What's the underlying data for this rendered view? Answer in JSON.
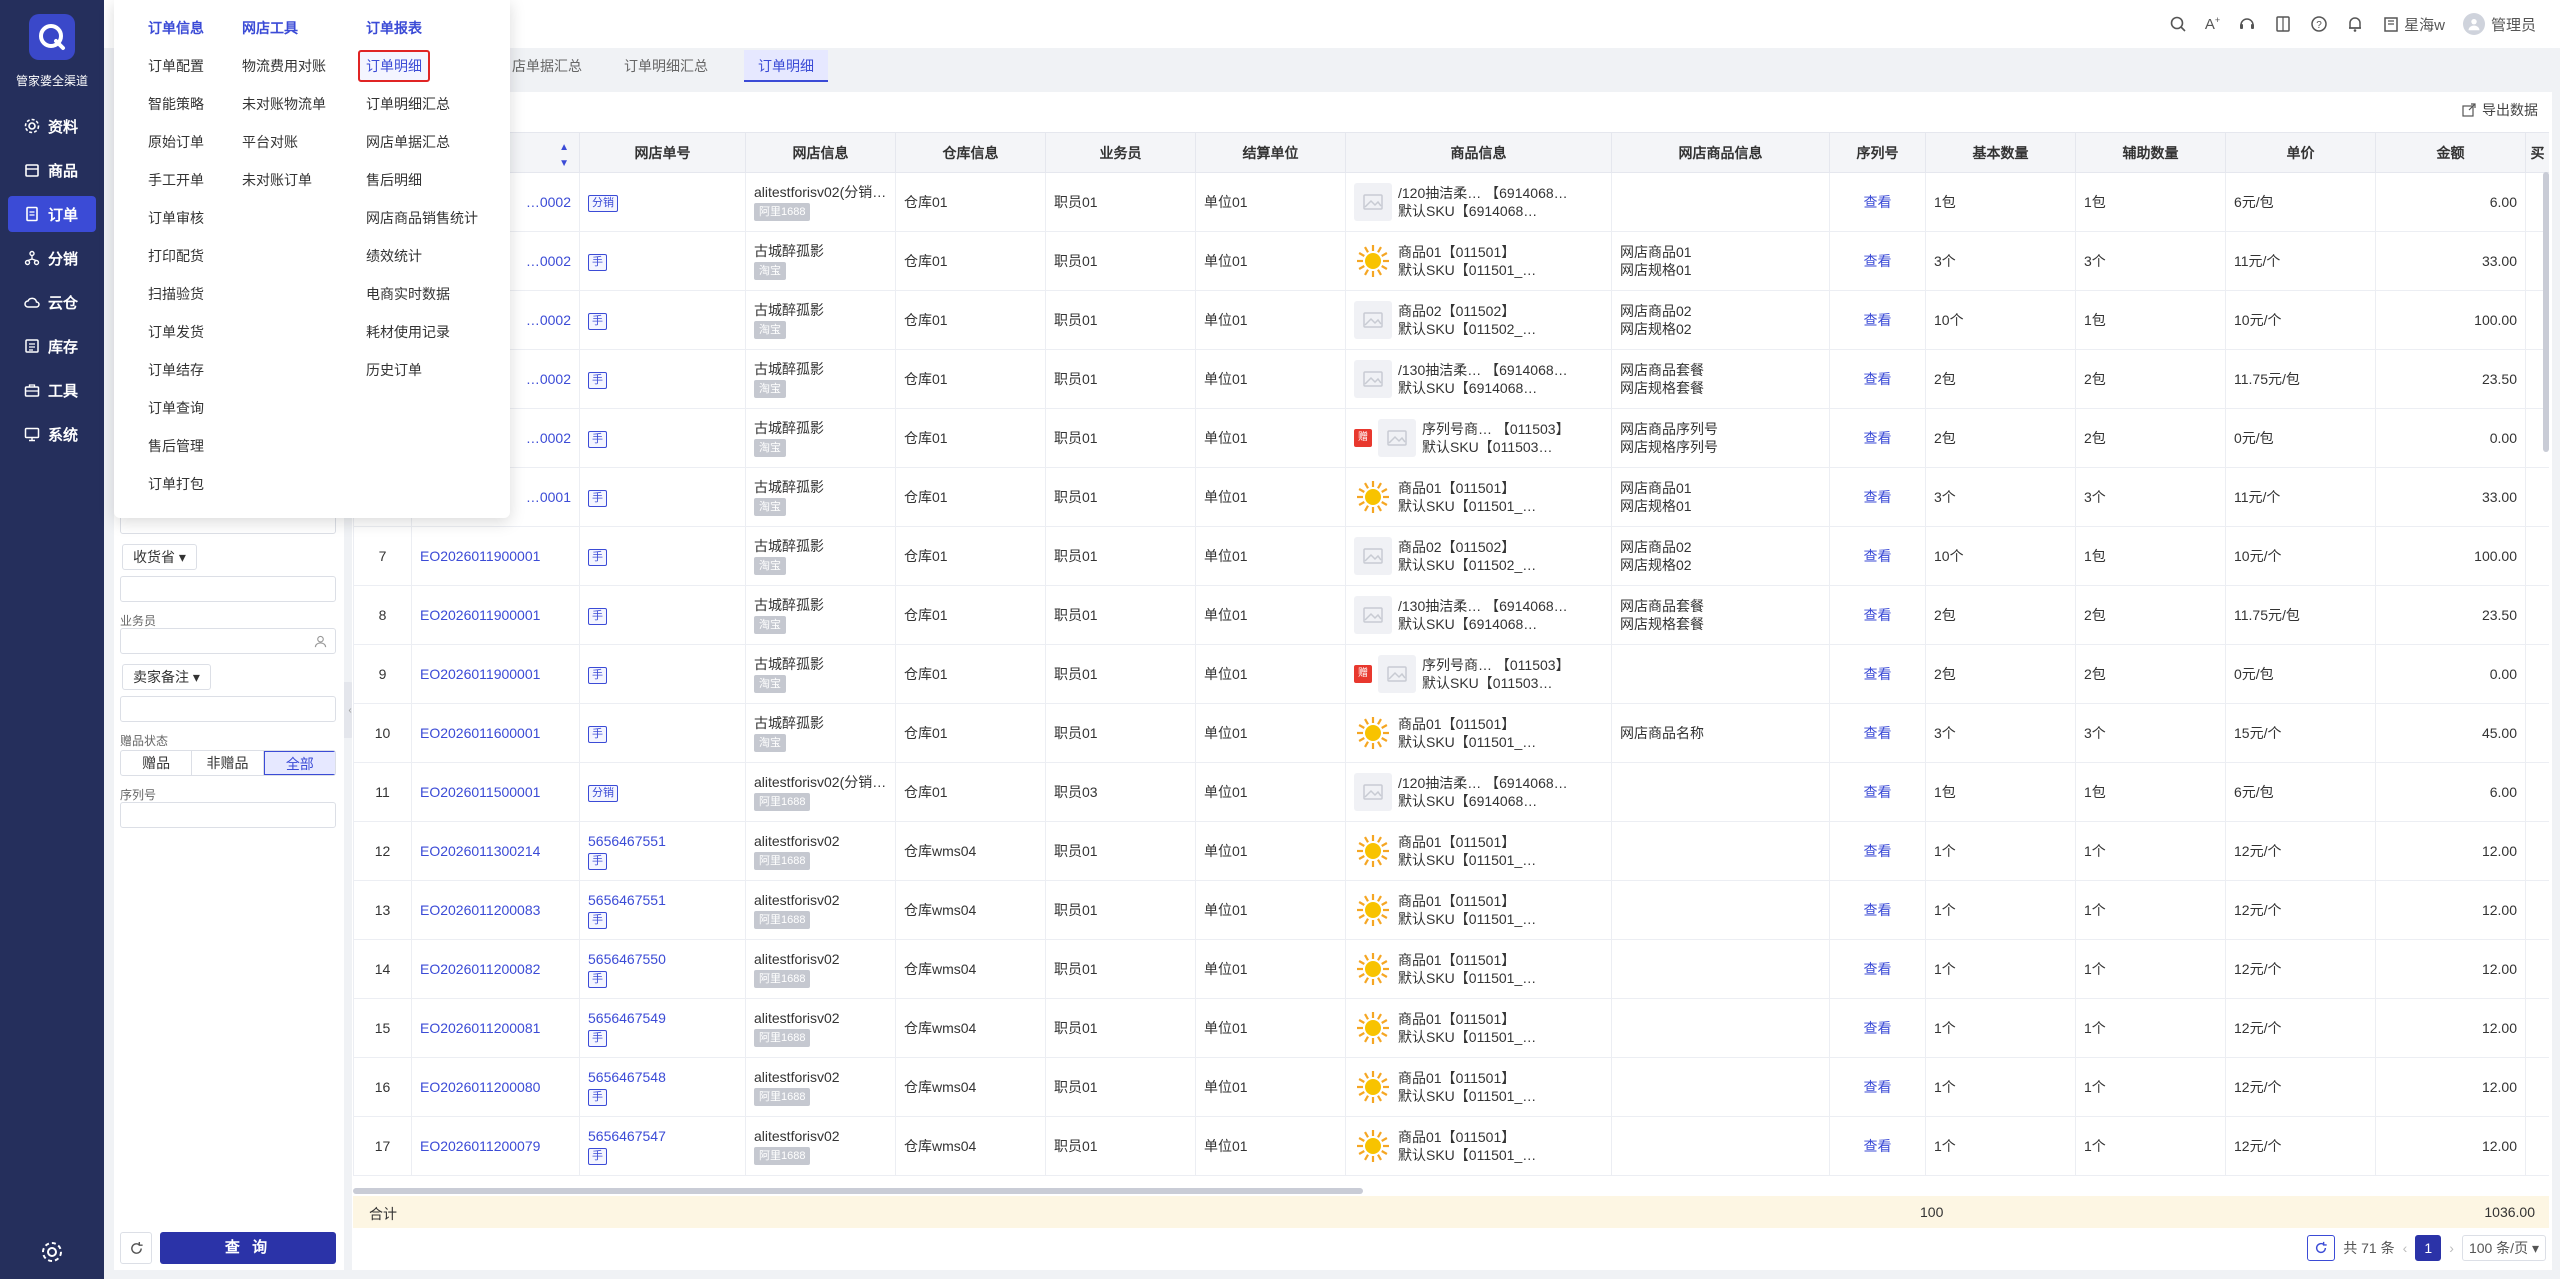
{
  "app": {
    "logo_text": "管家婆全渠道",
    "nav": [
      {
        "label": "资料",
        "icon": "gear-icon"
      },
      {
        "label": "商品",
        "icon": "box-icon"
      },
      {
        "label": "订单",
        "icon": "document-icon",
        "active": true
      },
      {
        "label": "分销",
        "icon": "network-icon"
      },
      {
        "label": "云仓",
        "icon": "cloud-icon"
      },
      {
        "label": "库存",
        "icon": "stack-icon"
      },
      {
        "label": "工具",
        "icon": "toolbox-icon"
      },
      {
        "label": "系统",
        "icon": "monitor-icon"
      }
    ],
    "accent": "#3b4bd6",
    "sidebar_bg": "#252f5c"
  },
  "header": {
    "store": "星海w",
    "user": "管理员",
    "icons": [
      "search-icon",
      "font-size-icon",
      "support-icon",
      "book-icon",
      "help-icon",
      "bell-icon"
    ]
  },
  "tabs": [
    {
      "label": "店单据汇总",
      "active": false
    },
    {
      "label": "订单明细汇总",
      "active": false
    },
    {
      "label": "订单明细",
      "active": true
    }
  ],
  "menu": {
    "columns": [
      {
        "header": "订单信息",
        "items": [
          "订单配置",
          "智能策略",
          "原始订单",
          "手工开单",
          "订单审核",
          "打印配货",
          "扫描验货",
          "订单发货",
          "订单结存",
          "订单查询",
          "售后管理",
          "订单打包"
        ]
      },
      {
        "header": "网店工具",
        "items": [
          "物流费用对账",
          "未对账物流单",
          "平台对账",
          "未对账订单"
        ]
      },
      {
        "header": "订单报表",
        "items": [
          "订单明细",
          "订单明细汇总",
          "网店单据汇总",
          "售后明细",
          "网店商品销售统计",
          "绩效统计",
          "电商实时数据",
          "耗材使用记录",
          "历史订单"
        ]
      }
    ],
    "highlighted": "订单明细"
  },
  "filter": {
    "province": "收货省",
    "salesman_label": "业务员",
    "seller_note": "卖家备注",
    "gift_label": "赠品状态",
    "gift_options": [
      "赠品",
      "非赠品",
      "全部"
    ],
    "gift_selected": "全部",
    "serial_label": "序列号",
    "query": "查 询"
  },
  "toolbar": {
    "export": "导出数据"
  },
  "table": {
    "columns": [
      "",
      "",
      "网店单号",
      "网店信息",
      "仓库信息",
      "业务员",
      "结算单位",
      "商品信息",
      "网店商品信息",
      "序列号",
      "基本数量",
      "辅助数量",
      "单价",
      "金额",
      "买"
    ],
    "rows": [
      {
        "idx": "",
        "order": "…0002",
        "shop_no": "",
        "tag": "分销",
        "shop": "alitestforisv02(分销…",
        "shop_tag": "阿里1688",
        "wh": "仓库01",
        "sales": "职员01",
        "unit": "单位01",
        "thumb": "img",
        "gift": false,
        "p1": "/120抽洁柔…  【6914068…",
        "p2": "默认SKU【6914068…",
        "sp1": "",
        "sp2": "",
        "serial": "查看",
        "q1": "1包",
        "q2": "1包",
        "price": "6元/包",
        "amt": "6.00"
      },
      {
        "idx": "",
        "order": "…0002",
        "shop_no": "",
        "tag": "手",
        "shop": "古城醉孤影",
        "shop_tag": "淘宝",
        "wh": "仓库01",
        "sales": "职员01",
        "unit": "单位01",
        "thumb": "sun",
        "gift": false,
        "p1": "商品01【011501】",
        "p2": "默认SKU【011501_…",
        "sp1": "网店商品01",
        "sp2": "网店规格01",
        "serial": "查看",
        "q1": "3个",
        "q2": "3个",
        "price": "11元/个",
        "amt": "33.00"
      },
      {
        "idx": "",
        "order": "…0002",
        "shop_no": "",
        "tag": "手",
        "shop": "古城醉孤影",
        "shop_tag": "淘宝",
        "wh": "仓库01",
        "sales": "职员01",
        "unit": "单位01",
        "thumb": "img",
        "gift": false,
        "p1": "商品02【011502】",
        "p2": "默认SKU【011502_…",
        "sp1": "网店商品02",
        "sp2": "网店规格02",
        "serial": "查看",
        "q1": "10个",
        "q2": "1包",
        "price": "10元/个",
        "amt": "100.00"
      },
      {
        "idx": "",
        "order": "…0002",
        "shop_no": "",
        "tag": "手",
        "shop": "古城醉孤影",
        "shop_tag": "淘宝",
        "wh": "仓库01",
        "sales": "职员01",
        "unit": "单位01",
        "thumb": "img",
        "gift": false,
        "p1": "/130抽洁柔…  【6914068…",
        "p2": "默认SKU【6914068…",
        "sp1": "网店商品套餐",
        "sp2": "网店规格套餐",
        "serial": "查看",
        "q1": "2包",
        "q2": "2包",
        "price": "11.75元/包",
        "amt": "23.50"
      },
      {
        "idx": "",
        "order": "…0002",
        "shop_no": "",
        "tag": "手",
        "shop": "古城醉孤影",
        "shop_tag": "淘宝",
        "wh": "仓库01",
        "sales": "职员01",
        "unit": "单位01",
        "thumb": "img",
        "gift": true,
        "p1": "序列号商…  【011503】",
        "p2": "默认SKU【011503…",
        "sp1": "网店商品序列号",
        "sp2": "网店规格序列号",
        "serial": "查看",
        "q1": "2包",
        "q2": "2包",
        "price": "0元/包",
        "amt": "0.00"
      },
      {
        "idx": "",
        "order": "…0001",
        "shop_no": "",
        "tag": "手",
        "shop": "古城醉孤影",
        "shop_tag": "淘宝",
        "wh": "仓库01",
        "sales": "职员01",
        "unit": "单位01",
        "thumb": "sun",
        "gift": false,
        "p1": "商品01【011501】",
        "p2": "默认SKU【011501_…",
        "sp1": "网店商品01",
        "sp2": "网店规格01",
        "serial": "查看",
        "q1": "3个",
        "q2": "3个",
        "price": "11元/个",
        "amt": "33.00"
      },
      {
        "idx": "7",
        "order": "EO2026011900001",
        "shop_no": "",
        "tag": "手",
        "shop": "古城醉孤影",
        "shop_tag": "淘宝",
        "wh": "仓库01",
        "sales": "职员01",
        "unit": "单位01",
        "thumb": "img",
        "gift": false,
        "p1": "商品02【011502】",
        "p2": "默认SKU【011502_…",
        "sp1": "网店商品02",
        "sp2": "网店规格02",
        "serial": "查看",
        "q1": "10个",
        "q2": "1包",
        "price": "10元/个",
        "amt": "100.00"
      },
      {
        "idx": "8",
        "order": "EO2026011900001",
        "shop_no": "",
        "tag": "手",
        "shop": "古城醉孤影",
        "shop_tag": "淘宝",
        "wh": "仓库01",
        "sales": "职员01",
        "unit": "单位01",
        "thumb": "img",
        "gift": false,
        "p1": "/130抽洁柔…  【6914068…",
        "p2": "默认SKU【6914068…",
        "sp1": "网店商品套餐",
        "sp2": "网店规格套餐",
        "serial": "查看",
        "q1": "2包",
        "q2": "2包",
        "price": "11.75元/包",
        "amt": "23.50"
      },
      {
        "idx": "9",
        "order": "EO2026011900001",
        "shop_no": "",
        "tag": "手",
        "shop": "古城醉孤影",
        "shop_tag": "淘宝",
        "wh": "仓库01",
        "sales": "职员01",
        "unit": "单位01",
        "thumb": "img",
        "gift": true,
        "p1": "序列号商…  【011503】",
        "p2": "默认SKU【011503…",
        "sp1": "",
        "sp2": "",
        "serial": "查看",
        "q1": "2包",
        "q2": "2包",
        "price": "0元/包",
        "amt": "0.00"
      },
      {
        "idx": "10",
        "order": "EO2026011600001",
        "shop_no": "",
        "tag": "手",
        "shop": "古城醉孤影",
        "shop_tag": "淘宝",
        "wh": "仓库01",
        "sales": "职员01",
        "unit": "单位01",
        "thumb": "sun",
        "gift": false,
        "p1": "商品01【011501】",
        "p2": "默认SKU【011501_…",
        "sp1": "网店商品名称",
        "sp2": "",
        "serial": "查看",
        "q1": "3个",
        "q2": "3个",
        "price": "15元/个",
        "amt": "45.00"
      },
      {
        "idx": "11",
        "order": "EO2026011500001",
        "shop_no": "",
        "tag": "分销",
        "shop": "alitestforisv02(分销…",
        "shop_tag": "阿里1688",
        "wh": "仓库01",
        "sales": "职员03",
        "unit": "单位01",
        "thumb": "img",
        "gift": false,
        "p1": "/120抽洁柔…  【6914068…",
        "p2": "默认SKU【6914068…",
        "sp1": "",
        "sp2": "",
        "serial": "查看",
        "q1": "1包",
        "q2": "1包",
        "price": "6元/包",
        "amt": "6.00"
      },
      {
        "idx": "12",
        "order": "EO2026011300214",
        "shop_no": "5656467551",
        "tag": "手",
        "shop": "alitestforisv02",
        "shop_tag": "阿里1688",
        "wh": "仓库wms04",
        "sales": "职员01",
        "unit": "单位01",
        "thumb": "sun",
        "gift": false,
        "p1": "商品01【011501】",
        "p2": "默认SKU【011501_…",
        "sp1": "",
        "sp2": "",
        "serial": "查看",
        "q1": "1个",
        "q2": "1个",
        "price": "12元/个",
        "amt": "12.00"
      },
      {
        "idx": "13",
        "order": "EO2026011200083",
        "shop_no": "5656467551",
        "tag": "手",
        "shop": "alitestforisv02",
        "shop_tag": "阿里1688",
        "wh": "仓库wms04",
        "sales": "职员01",
        "unit": "单位01",
        "thumb": "sun",
        "gift": false,
        "p1": "商品01【011501】",
        "p2": "默认SKU【011501_…",
        "sp1": "",
        "sp2": "",
        "serial": "查看",
        "q1": "1个",
        "q2": "1个",
        "price": "12元/个",
        "amt": "12.00"
      },
      {
        "idx": "14",
        "order": "EO2026011200082",
        "shop_no": "5656467550",
        "tag": "手",
        "shop": "alitestforisv02",
        "shop_tag": "阿里1688",
        "wh": "仓库wms04",
        "sales": "职员01",
        "unit": "单位01",
        "thumb": "sun",
        "gift": false,
        "p1": "商品01【011501】",
        "p2": "默认SKU【011501_…",
        "sp1": "",
        "sp2": "",
        "serial": "查看",
        "q1": "1个",
        "q2": "1个",
        "price": "12元/个",
        "amt": "12.00"
      },
      {
        "idx": "15",
        "order": "EO2026011200081",
        "shop_no": "5656467549",
        "tag": "手",
        "shop": "alitestforisv02",
        "shop_tag": "阿里1688",
        "wh": "仓库wms04",
        "sales": "职员01",
        "unit": "单位01",
        "thumb": "sun",
        "gift": false,
        "p1": "商品01【011501】",
        "p2": "默认SKU【011501_…",
        "sp1": "",
        "sp2": "",
        "serial": "查看",
        "q1": "1个",
        "q2": "1个",
        "price": "12元/个",
        "amt": "12.00"
      },
      {
        "idx": "16",
        "order": "EO2026011200080",
        "shop_no": "5656467548",
        "tag": "手",
        "shop": "alitestforisv02",
        "shop_tag": "阿里1688",
        "wh": "仓库wms04",
        "sales": "职员01",
        "unit": "单位01",
        "thumb": "sun",
        "gift": false,
        "p1": "商品01【011501】",
        "p2": "默认SKU【011501_…",
        "sp1": "",
        "sp2": "",
        "serial": "查看",
        "q1": "1个",
        "q2": "1个",
        "price": "12元/个",
        "amt": "12.00"
      },
      {
        "idx": "17",
        "order": "EO2026011200079",
        "shop_no": "5656467547",
        "tag": "手",
        "shop": "alitestforisv02",
        "shop_tag": "阿里1688",
        "wh": "仓库wms04",
        "sales": "职员01",
        "unit": "单位01",
        "thumb": "sun",
        "gift": false,
        "p1": "商品01【011501】",
        "p2": "默认SKU【011501_…",
        "sp1": "",
        "sp2": "",
        "serial": "查看",
        "q1": "1个",
        "q2": "1个",
        "price": "12元/个",
        "amt": "12.00"
      }
    ],
    "total_label": "合计",
    "total_qty": "100",
    "total_amount": "1036.00"
  },
  "pagination": {
    "total": "共 71 条",
    "current": "1",
    "page_size": "100 条/页"
  }
}
